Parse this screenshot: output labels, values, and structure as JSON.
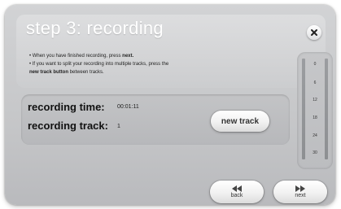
{
  "dialog": {
    "title": "step 3: recording",
    "instructions": {
      "line1_prefix": "• When you have finished recording, press ",
      "line1_bold": "next.",
      "line2": "• If you want to split your recording into multiple tracks, press the",
      "line3_bold": "new track button",
      "line3_suffix": " between tracks."
    },
    "close_icon": "close-x-icon"
  },
  "recording": {
    "time_label": "recording time:",
    "time_value": "00:01:11",
    "track_label": "recording track:",
    "track_value": "1",
    "new_track_label": "new track"
  },
  "meter": {
    "ticks": [
      "0",
      "6",
      "12",
      "18",
      "24",
      "30"
    ]
  },
  "nav": {
    "back_label": "back",
    "back_icon": "rewind-icon",
    "next_label": "next",
    "next_icon": "fast-forward-icon"
  },
  "colors": {
    "dialog_background": "#c8c9cb",
    "title_text": "#ffffff",
    "button_face": "#f1f1f1"
  }
}
